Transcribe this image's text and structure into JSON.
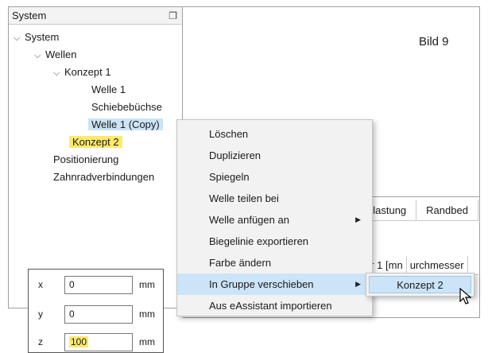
{
  "panel": {
    "title": "System",
    "float_icon": "float-window-icon"
  },
  "tree": {
    "system": "System",
    "wellen": "Wellen",
    "konzept1": "Konzept 1",
    "welle1": "Welle 1",
    "schiebe": "Schiebebüchse",
    "welle1copy": "Welle 1 (Copy)",
    "konzept2": "Konzept 2",
    "positionierung": "Positionierung",
    "zahnrad": "Zahnradverbindungen"
  },
  "view": {
    "label": "Bild 9"
  },
  "tabs": [
    "elastung",
    "Randbed"
  ],
  "columns": [
    "er 1 [mn",
    "urchmesser"
  ],
  "menu": {
    "items": [
      "Löschen",
      "Duplizieren",
      "Spiegeln",
      "Welle teilen bei",
      "Welle anfügen an",
      "Biegelinie exportieren",
      "Farbe ändern",
      "In Gruppe verschieben",
      "Aus eAssistant importieren"
    ],
    "submenu_label": "Konzept 2"
  },
  "coords": {
    "x": {
      "label": "x",
      "value": "0",
      "unit": "mm"
    },
    "y": {
      "label": "y",
      "value": "0",
      "unit": "mm"
    },
    "z": {
      "label": "z",
      "value": "100",
      "unit": "mm"
    }
  },
  "colors": {
    "highlight_yellow": "#fde96b",
    "selection_blue": "#cce4f7"
  }
}
